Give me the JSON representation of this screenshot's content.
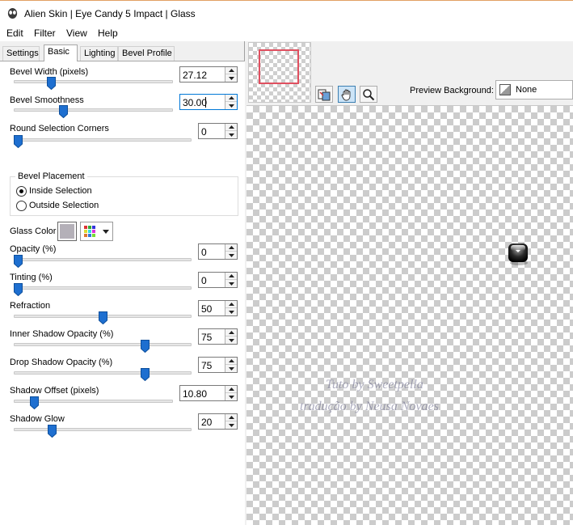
{
  "window": {
    "title": "Alien Skin | Eye Candy 5 Impact | Glass"
  },
  "menu": [
    "Edit",
    "Filter",
    "View",
    "Help"
  ],
  "tabs": [
    "Settings",
    "Basic",
    "Lighting",
    "Bevel Profile"
  ],
  "active_tab": "Basic",
  "controls": {
    "bevel_width": {
      "label": "Bevel Width (pixels)",
      "value": "27.12",
      "level": 0.22
    },
    "bevel_smoothness": {
      "label": "Bevel Smoothness",
      "value": "30.00",
      "level": 0.3
    },
    "round_corners": {
      "label": "Round Selection Corners",
      "value": "0",
      "level": 0.0
    },
    "opacity": {
      "label": "Opacity (%)",
      "value": "0",
      "level": 0.0
    },
    "tinting": {
      "label": "Tinting (%)",
      "value": "0",
      "level": 0.0
    },
    "refraction": {
      "label": "Refraction",
      "value": "50",
      "level": 0.5
    },
    "inner_shadow_opacity": {
      "label": "Inner Shadow Opacity (%)",
      "value": "75",
      "level": 0.75
    },
    "drop_shadow_opacity": {
      "label": "Drop Shadow Opacity (%)",
      "value": "75",
      "level": 0.75
    },
    "shadow_offset": {
      "label": "Shadow Offset (pixels)",
      "value": "10.80",
      "level": 0.11
    },
    "shadow_glow": {
      "label": "Shadow Glow",
      "value": "20",
      "level": 0.2
    }
  },
  "bevel_placement": {
    "legend": "Bevel Placement",
    "options": [
      "Inside Selection",
      "Outside Selection"
    ],
    "selected": "Inside Selection"
  },
  "glass_color": {
    "label": "Glass Color",
    "color": "#b4b0b8"
  },
  "preview_background": {
    "label": "Preview Background:",
    "value": "None"
  },
  "watermark": {
    "line1": "Tuto by Sweetpella",
    "line2": "tradução by Neusa Novaes"
  },
  "colors": {
    "accent": "#0078d7",
    "thumb": "#1e6fd0",
    "frame": "#e05060"
  }
}
